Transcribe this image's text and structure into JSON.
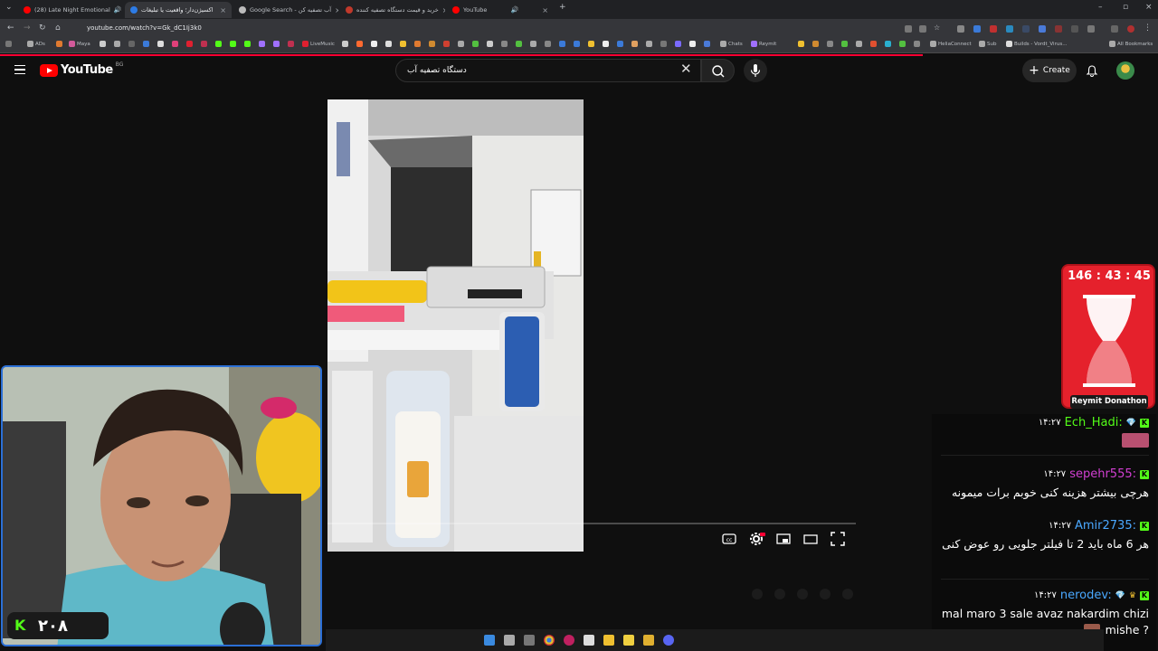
{
  "browser": {
    "tabs": [
      {
        "label": "(28) Late Night Emotional",
        "active": false
      },
      {
        "label": "آب اکسیژن‌دار؛ واقعیت یا تبلیغات",
        "active": true
      },
      {
        "label": "Google Search - آب تصفیه کن",
        "active": false
      },
      {
        "label": "خرید و قیمت دستگاه تصفیه کننده",
        "active": false
      },
      {
        "label": "YouTube",
        "active": false
      }
    ],
    "url": "youtube.com/watch?v=Gk_dC1Ij3k0",
    "bookmarks": [
      "ADs",
      "Maya",
      "LiveMusic",
      "Chats",
      "Reymit",
      "HeliaConnect",
      "Sub",
      "Builds - Vordt_Virus...",
      "All Bookmarks"
    ]
  },
  "youtube": {
    "logo_text": "YouTube",
    "region": "BG",
    "search_value": "دستگاه تصفیه آب",
    "create_label": "Create"
  },
  "overlay": {
    "subscriber_count": "۲۰۸",
    "donathon_timer": "146 : 43 : 45",
    "donathon_label": "Reymit Donathon"
  },
  "chat": {
    "messages": [
      {
        "time": "۱۴:۲۷",
        "user": "Ech_Hadi",
        "user_color": "#53fc18",
        "badge": "gem",
        "body": ""
      },
      {
        "time": "۱۴:۲۷",
        "user": "sepehr555",
        "user_color": "#d23fd2",
        "badge": "",
        "body": "هرچی بیشتر هزینه کنی خوبم برات میمونه"
      },
      {
        "time": "۱۴:۲۷",
        "user": "Amir2735",
        "user_color": "#4aa8ff",
        "badge": "",
        "body": "هر 6 ماه باید 2 تا فیلتر جلویی رو عوض کنی"
      },
      {
        "time": "۱۴:۲۷",
        "user": "nerodev",
        "user_color": "#4aa8ff",
        "badge": "gem",
        "body": "mal maro 3 sale avaz nakardim chizi mishe ?"
      }
    ]
  }
}
